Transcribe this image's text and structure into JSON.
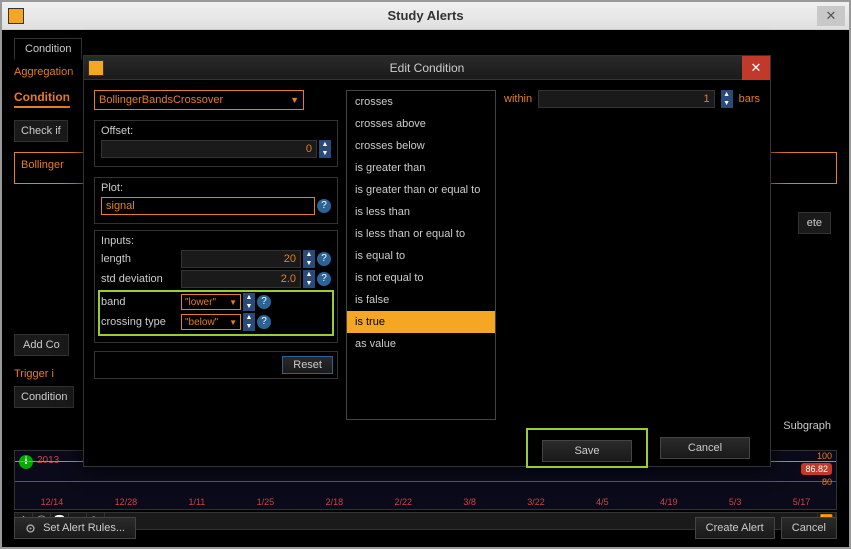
{
  "outer": {
    "title": "Study Alerts",
    "tabs": [
      "Condition"
    ],
    "aggregation_label": "Aggregation",
    "condition_label": "Condition",
    "check_if": "Check if",
    "study_name": "Bollinger",
    "add_condition": "Add Co",
    "trigger_label": "Trigger i",
    "condition2": "Condition",
    "subgraph": "Subgraph",
    "delete": "ete"
  },
  "modal": {
    "title": "Edit Condition",
    "study_select": "BollingerBandsCrossover",
    "offset": {
      "label": "Offset:",
      "value": "0"
    },
    "plot": {
      "label": "Plot:",
      "value": "signal"
    },
    "inputs": {
      "label": "Inputs:",
      "length": {
        "name": "length",
        "value": "20"
      },
      "std_dev": {
        "name": "std deviation",
        "value": "2.0"
      },
      "band": {
        "name": "band",
        "value": "\"lower\""
      },
      "crossing": {
        "name": "crossing type",
        "value": "\"below\""
      }
    },
    "reset": "Reset",
    "conditions": [
      "crosses",
      "crosses above",
      "crosses below",
      "is greater than",
      "is greater than or equal to",
      "is less than",
      "is less than or equal to",
      "is equal to",
      "is not equal to",
      "is false",
      "is true",
      "as value"
    ],
    "selected_condition": "is true",
    "within": {
      "label": "within",
      "value": "1",
      "unit": "bars"
    },
    "save": "Save",
    "cancel": "Cancel"
  },
  "chart": {
    "year": "2013",
    "dates": [
      "12/14",
      "12/28",
      "1/11",
      "1/25",
      "2/18",
      "2/22",
      "3/8",
      "3/22",
      "4/5",
      "4/19",
      "5/3",
      "5/17"
    ],
    "val_top": "100",
    "val_mid": "80",
    "badge": "86.82"
  },
  "bottom": {
    "set_rules": "Set Alert Rules...",
    "create": "Create Alert",
    "cancel": "Cancel"
  }
}
